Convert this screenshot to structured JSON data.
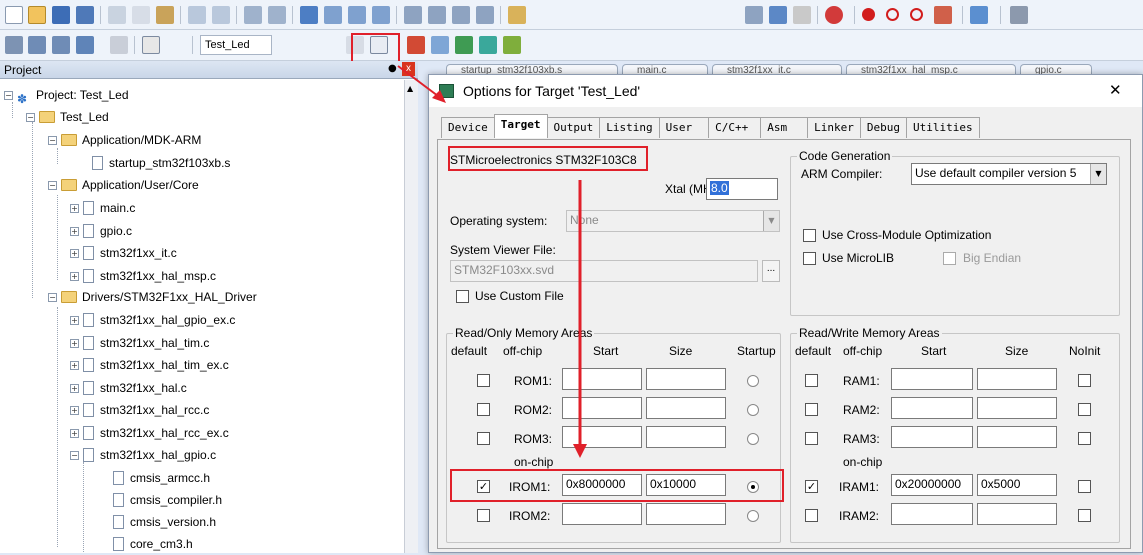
{
  "toolbar": {
    "target_name": "Test_Led"
  },
  "project_panel": {
    "title": "Project",
    "pin": "←",
    "close": "x",
    "items": [
      {
        "label": "Project: Test_Led"
      },
      {
        "label": "Test_Led"
      },
      {
        "label": "Application/MDK-ARM"
      },
      {
        "label": "startup_stm32f103xb.s"
      },
      {
        "label": "Application/User/Core"
      },
      {
        "label": "main.c"
      },
      {
        "label": "gpio.c"
      },
      {
        "label": "stm32f1xx_it.c"
      },
      {
        "label": "stm32f1xx_hal_msp.c"
      },
      {
        "label": "Drivers/STM32F1xx_HAL_Driver"
      },
      {
        "label": "stm32f1xx_hal_gpio_ex.c"
      },
      {
        "label": "stm32f1xx_hal_tim.c"
      },
      {
        "label": "stm32f1xx_hal_tim_ex.c"
      },
      {
        "label": "stm32f1xx_hal.c"
      },
      {
        "label": "stm32f1xx_hal_rcc.c"
      },
      {
        "label": "stm32f1xx_hal_rcc_ex.c"
      },
      {
        "label": "stm32f1xx_hal_gpio.c"
      },
      {
        "label": "cmsis_armcc.h"
      },
      {
        "label": "cmsis_compiler.h"
      },
      {
        "label": "cmsis_version.h"
      },
      {
        "label": "core_cm3.h"
      }
    ]
  },
  "editor_tabs": [
    "startup_stm32f103xb.s",
    "main.c",
    "stm32f1xx_it.c",
    "stm32f1xx_hal_msp.c",
    "gpio.c"
  ],
  "dialog": {
    "title": "Options for Target 'Test_Led'",
    "close": "✕",
    "tabs": [
      "Device",
      "Target",
      "Output",
      "Listing",
      "User",
      "C/C++",
      "Asm",
      "Linker",
      "Debug",
      "Utilities"
    ],
    "device": "STMicroelectronics STM32F103C8",
    "xtal_label": "Xtal (MHz):",
    "xtal_value": "8.0",
    "os_label": "Operating system:",
    "os_value": "None",
    "svf_label": "System Viewer File:",
    "svf_value": "STM32F103xx.svd",
    "svf_browse": "...",
    "custom_file": "Use Custom File",
    "codegen": {
      "title": "Code Generation",
      "compiler_label": "ARM Compiler:",
      "compiler_value": "Use default compiler version 5",
      "cross_module": "Use Cross-Module Optimization",
      "microlib": "Use MicroLIB",
      "big_endian": "Big Endian"
    },
    "rom": {
      "title": "Read/Only Memory Areas",
      "headers": [
        "default",
        "off-chip",
        "Start",
        "Size",
        "Startup"
      ],
      "onchip": "on-chip",
      "rows": [
        {
          "name": "ROM1:",
          "start": "",
          "size": "",
          "default": false,
          "startup": false
        },
        {
          "name": "ROM2:",
          "start": "",
          "size": "",
          "default": false,
          "startup": false
        },
        {
          "name": "ROM3:",
          "start": "",
          "size": "",
          "default": false,
          "startup": false
        },
        {
          "name": "IROM1:",
          "start": "0x8000000",
          "size": "0x10000",
          "default": true,
          "startup": true
        },
        {
          "name": "IROM2:",
          "start": "",
          "size": "",
          "default": false,
          "startup": false
        }
      ]
    },
    "ram": {
      "title": "Read/Write Memory Areas",
      "headers": [
        "default",
        "off-chip",
        "Start",
        "Size",
        "NoInit"
      ],
      "onchip": "on-chip",
      "rows": [
        {
          "name": "RAM1:",
          "start": "",
          "size": "",
          "default": false,
          "noinit": false
        },
        {
          "name": "RAM2:",
          "start": "",
          "size": "",
          "default": false,
          "noinit": false
        },
        {
          "name": "RAM3:",
          "start": "",
          "size": "",
          "default": false,
          "noinit": false
        },
        {
          "name": "IRAM1:",
          "start": "0x20000000",
          "size": "0x5000",
          "default": true,
          "noinit": false
        },
        {
          "name": "IRAM2:",
          "start": "",
          "size": "",
          "default": false,
          "noinit": false
        }
      ]
    }
  },
  "colors": {
    "highlight": "#e0202a",
    "selection": "#3170d8"
  }
}
